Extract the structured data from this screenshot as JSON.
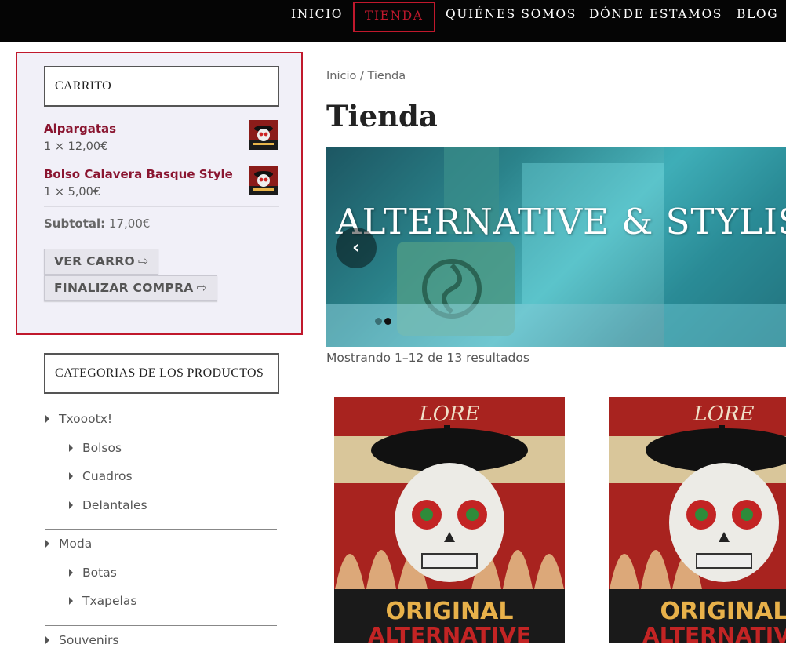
{
  "nav": {
    "items": [
      {
        "label": "INICIO"
      },
      {
        "label": "TIENDA",
        "active": true
      },
      {
        "label": "QUIÉNES SOMOS"
      },
      {
        "label": "DÓNDE ESTAMOS"
      },
      {
        "label": "BLOG"
      }
    ]
  },
  "cart": {
    "title": "CARRITO",
    "items": [
      {
        "name": "Alpargatas",
        "qty_price": "1 × 12,00€"
      },
      {
        "name": "Bolso Calavera Basque Style",
        "qty_price": "1 × 5,00€"
      }
    ],
    "subtotal_label": "Subtotal:",
    "subtotal_value": "17,00€",
    "view_cart_label": "VER CARRO",
    "checkout_label": "FINALIZAR COMPRA"
  },
  "categories": {
    "title": "CATEGORIAS DE LOS PRODUCTOS",
    "groups": [
      {
        "label": "Txoootx!",
        "children": [
          "Bolsos",
          "Cuadros",
          "Delantales"
        ]
      },
      {
        "label": "Moda",
        "children": [
          "Botas",
          "Txapelas"
        ]
      },
      {
        "label": "Souvenirs",
        "children": []
      }
    ]
  },
  "main": {
    "breadcrumb": "Inicio / Tienda",
    "title": "Tienda",
    "slider_caption": "ALTERNATIVE & STYLISH",
    "result_count": "Mostrando 1–12 de 13 resultados"
  },
  "product_artwork": {
    "top_text": "LORE",
    "bottom_text_1": "ORIGINAL",
    "bottom_text_2": "ALTERNATIVE"
  },
  "colors": {
    "accent_red": "#c0182c",
    "product_link": "#8a1530",
    "nav_bg": "#050505",
    "sidebar_bg": "#f1f0f8"
  }
}
